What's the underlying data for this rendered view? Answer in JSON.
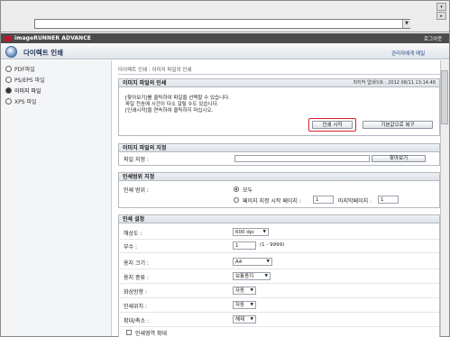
{
  "browser": {
    "address_value": ""
  },
  "header": {
    "brand": "imageRUNNER ADVANCE",
    "logout": "로그아웃",
    "app_title": "다이렉트 인쇄",
    "admin_link": "관리자에게 메일"
  },
  "sidebar": {
    "items": [
      {
        "label": "PDF파일",
        "active": false
      },
      {
        "label": "PS/EPS 파일",
        "active": false
      },
      {
        "label": "이미지 파일",
        "active": true
      },
      {
        "label": "XPS 파일",
        "active": false
      }
    ]
  },
  "main": {
    "breadcrumb": "다이렉트 인쇄 : 이미지 파일의 인쇄",
    "print_panel": {
      "title": "이미지 파일의 인쇄",
      "last_update": "마지막 업데이트 : 2012 08/11 13:14:48",
      "messages": [
        "[찾아보기]를 클릭하여 파일을 선택할 수 있습니다.",
        "파일 전송에 시간이 다소 걸릴 수도 있습니다.",
        "[인쇄시작]을 연속하여 클릭하지 마십시오."
      ],
      "start_button": "인쇄 시작",
      "reset_button": "기본값으로 복구"
    },
    "file_panel": {
      "title": "이미지 파일의 지정",
      "file_label": "파일 지정 :",
      "browse_button": "찾아보기"
    },
    "range_panel": {
      "title": "인쇄범위 지정",
      "range_label": "인쇄 범위 :",
      "option_all": "모두",
      "option_pages": "페이지 지정 시작 페이지 :",
      "start_page_value": "1",
      "end_page_label": "마지막페이지 :",
      "end_page_value": "1"
    },
    "settings_panel": {
      "title": "인쇄 설정",
      "resolution_label": "해상도 :",
      "resolution_value": "600 dpi",
      "copies_label": "부수 :",
      "copies_value": "1",
      "copies_range": "(1 - 9999)",
      "paper_size_label": "용지 크기 :",
      "paper_size_value": "A4",
      "paper_type_label": "용지 종류 :",
      "paper_type_value": "보통용지",
      "orientation_label": "화상방향 :",
      "orientation_value": "자동",
      "position_label": "인쇄위치 :",
      "position_value": "자동",
      "zoom_label": "확대/축소 :",
      "zoom_value": "해제",
      "fit_label": "인쇄영역 확대"
    }
  }
}
